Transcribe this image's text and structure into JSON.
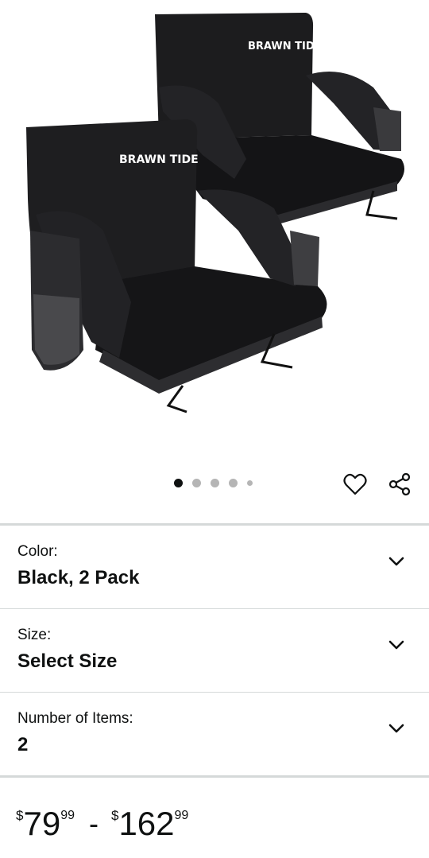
{
  "product": {
    "brand_logo": "BRAWN TIDE",
    "image_alt": "Brawn Tide stadium seats, black, 2 pack",
    "carousel": {
      "total": 5,
      "active_index": 0
    },
    "actions": {
      "favorite_icon": "heart-icon",
      "share_icon": "share-icon"
    }
  },
  "options": [
    {
      "label": "Color:",
      "value": "Black, 2 Pack"
    },
    {
      "label": "Size:",
      "value": "Select Size"
    },
    {
      "label": "Number of Items:",
      "value": "2"
    }
  ],
  "price": {
    "symbol": "$",
    "low_whole": "79",
    "low_fraction": "99",
    "separator": "-",
    "high_whole": "162",
    "high_fraction": "99"
  },
  "colors": {
    "text": "#0f1111",
    "divider": "#d5d9d9",
    "dot_active": "#0f1111",
    "dot_inactive": "#b5b5b5"
  }
}
